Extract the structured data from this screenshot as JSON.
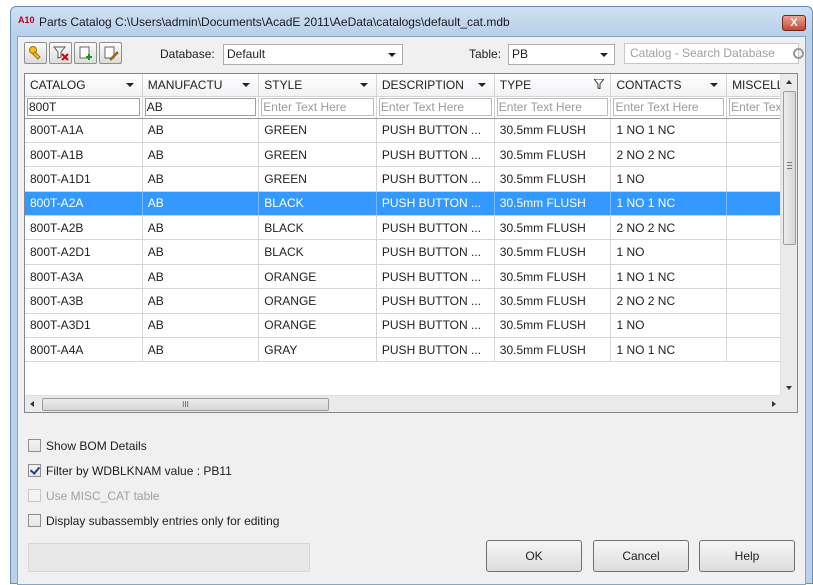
{
  "window": {
    "app_icon": "A10",
    "title": "Parts Catalog C:\\Users\\admin\\Documents\\AcadE 2011\\AeData\\catalogs\\default_cat.mdb",
    "close_label": "X"
  },
  "toolbar": {
    "database_label": "Database:",
    "database_value": "Default",
    "table_label": "Table:",
    "table_value": "PB",
    "search_placeholder": "Catalog - Search Database"
  },
  "grid": {
    "columns": [
      "CATALOG",
      "MANUFACTU",
      "STYLE",
      "DESCRIPTION",
      "TYPE",
      "CONTACTS",
      "MISCELL"
    ],
    "filters": [
      "800T",
      "AB",
      "Enter Text Here",
      "Enter Text Here",
      "Enter Text Here",
      "Enter Text Here",
      "Enter Text"
    ],
    "rows": [
      [
        "800T-A1A",
        "AB",
        "GREEN",
        "PUSH BUTTON ...",
        "30.5mm FLUSH",
        "1 NO 1 NC",
        ""
      ],
      [
        "800T-A1B",
        "AB",
        "GREEN",
        "PUSH BUTTON ...",
        "30.5mm FLUSH",
        "2 NO 2 NC",
        ""
      ],
      [
        "800T-A1D1",
        "AB",
        "GREEN",
        "PUSH BUTTON ...",
        "30.5mm FLUSH",
        "1 NO",
        ""
      ],
      [
        "800T-A2A",
        "AB",
        "BLACK",
        "PUSH BUTTON ...",
        "30.5mm FLUSH",
        "1 NO 1 NC",
        ""
      ],
      [
        "800T-A2B",
        "AB",
        "BLACK",
        "PUSH BUTTON ...",
        "30.5mm FLUSH",
        "2 NO 2 NC",
        ""
      ],
      [
        "800T-A2D1",
        "AB",
        "BLACK",
        "PUSH BUTTON ...",
        "30.5mm FLUSH",
        "1 NO",
        ""
      ],
      [
        "800T-A3A",
        "AB",
        "ORANGE",
        "PUSH BUTTON ...",
        "30.5mm FLUSH",
        "1 NO 1 NC",
        ""
      ],
      [
        "800T-A3B",
        "AB",
        "ORANGE",
        "PUSH BUTTON ...",
        "30.5mm FLUSH",
        "2 NO 2 NC",
        ""
      ],
      [
        "800T-A3D1",
        "AB",
        "ORANGE",
        "PUSH BUTTON ...",
        "30.5mm FLUSH",
        "1 NO",
        ""
      ],
      [
        "800T-A4A",
        "AB",
        "GRAY",
        "PUSH BUTTON ...",
        "30.5mm FLUSH",
        "1 NO 1 NC",
        ""
      ]
    ],
    "selected_row": 3,
    "hscroll_grip": "III"
  },
  "options": {
    "show_bom": "Show BOM Details",
    "filter_wdblknam": "Filter by WDBLKNAM value : PB11",
    "use_misc_cat": "Use MISC_CAT table",
    "display_subassembly": "Display subassembly entries only for editing"
  },
  "buttons": {
    "ok": "OK",
    "cancel": "Cancel",
    "help": "Help"
  },
  "colors": {
    "selection": "#3399ff",
    "title_bar": "#b9d1ea",
    "close_button": "#c44a31"
  }
}
